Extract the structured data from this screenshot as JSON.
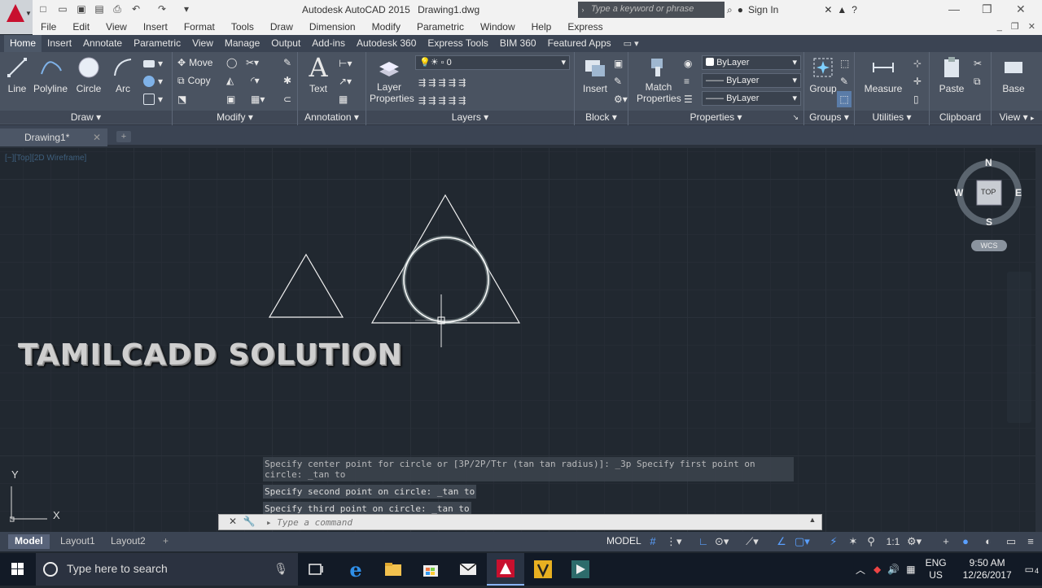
{
  "window": {
    "app_name": "Autodesk AutoCAD 2015",
    "document_name": "Drawing1.dwg",
    "search_placeholder": "Type a keyword or phrase",
    "sign_in": "Sign In"
  },
  "menu": [
    "File",
    "Edit",
    "View",
    "Insert",
    "Format",
    "Tools",
    "Draw",
    "Dimension",
    "Modify",
    "Parametric",
    "Window",
    "Help",
    "Express"
  ],
  "ribbon_tabs": [
    "Home",
    "Insert",
    "Annotate",
    "Parametric",
    "View",
    "Manage",
    "Output",
    "Add-ins",
    "Autodesk 360",
    "Express Tools",
    "BIM 360",
    "Featured Apps"
  ],
  "ribbon": {
    "draw": {
      "title": "Draw",
      "line": "Line",
      "polyline": "Polyline",
      "circle": "Circle",
      "arc": "Arc"
    },
    "modify": {
      "title": "Modify",
      "move": "Move",
      "copy": "Copy"
    },
    "annotation": {
      "title": "Annotation",
      "text": "Text"
    },
    "layers": {
      "title": "Layers",
      "layer_properties": "Layer\nProperties",
      "current_layer": "0"
    },
    "block": {
      "title": "Block",
      "insert": "Insert"
    },
    "properties": {
      "title": "Properties",
      "match": "Match\nProperties",
      "color": "ByLayer",
      "linetype": "ByLayer",
      "lineweight": "ByLayer"
    },
    "groups": {
      "title": "Groups",
      "group": "Group"
    },
    "utilities": {
      "title": "Utilities",
      "measure": "Measure"
    },
    "clipboard": {
      "title": "Clipboard",
      "paste": "Paste"
    },
    "view": {
      "title": "View",
      "base": "Base"
    }
  },
  "doc_tab": "Drawing1*",
  "viewport": {
    "label": "[−][Top][2D Wireframe]",
    "watermark": "TAMILCADD SOLUTION",
    "viewcube": {
      "n": "N",
      "s": "S",
      "e": "E",
      "w": "W",
      "top": "TOP",
      "wcs": "WCS"
    },
    "ucs_x": "X",
    "ucs_y": "Y"
  },
  "command": {
    "history": [
      "Specify center point for circle or [3P/2P/Ttr (tan tan radius)]: _3p Specify first point on circle: _tan to",
      "Specify second point on circle: _tan to",
      "Specify third point on circle: _tan to"
    ],
    "placeholder": "Type a command"
  },
  "layout_tabs": [
    "Model",
    "Layout1",
    "Layout2"
  ],
  "status": {
    "model": "MODEL",
    "scale": "1:1"
  },
  "taskbar": {
    "search_placeholder": "Type here to search",
    "lang_line1": "ENG",
    "lang_line2": "US",
    "time": "9:50 AM",
    "date": "12/26/2017",
    "notifications": "4"
  },
  "colors": {
    "ribbon": "#4a5361",
    "canvas": "#212830",
    "accent": "#c8102e"
  }
}
